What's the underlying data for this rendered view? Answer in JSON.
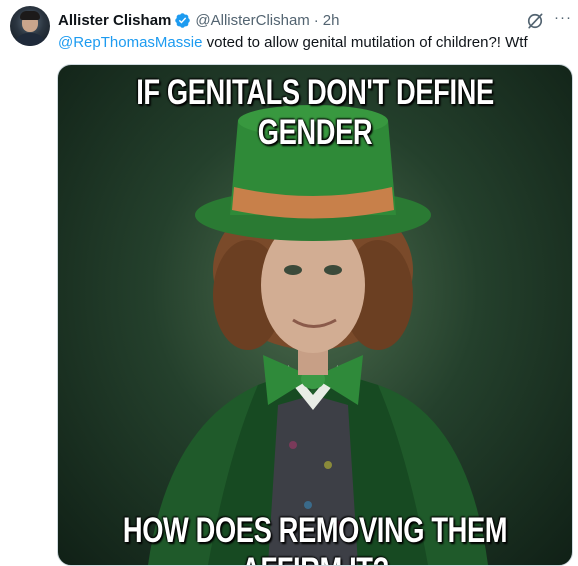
{
  "tweet": {
    "author_name": "Allister Clisham",
    "handle": "@AllisterClisham",
    "separator": "·",
    "time": "2h",
    "mention": "@RepThomasMassie",
    "body": " voted to allow genital mutilation of children?!  Wtf",
    "more_label": "···"
  },
  "media": {
    "top_text": "IF GENITALS DON'T DEFINE GENDER",
    "bottom_text": "HOW DOES REMOVING THEM AFFIRM IT?"
  },
  "colors": {
    "accent": "#1d9bf0",
    "secondary_text": "#536471",
    "hat_green": "#2f7d35"
  },
  "icons": [
    "verified-badge-icon",
    "grok-icon",
    "more-icon"
  ]
}
